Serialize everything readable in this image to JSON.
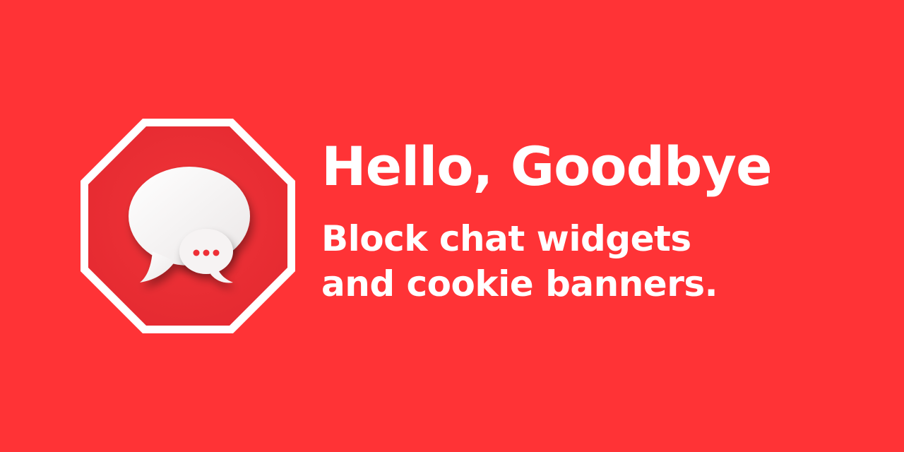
{
  "background_color": "#ff3336",
  "logo": {
    "icon": "stop-sign-chat-bubbles-icon",
    "octagon_color": "#ee2f36",
    "border_color": "#ffffff",
    "bubble_color": "#f4f1f1",
    "dots_color": "#ee2f36"
  },
  "headline": "Hello, Goodbye",
  "tagline": {
    "line1": "Block chat widgets",
    "line2": "and cookie banners."
  }
}
